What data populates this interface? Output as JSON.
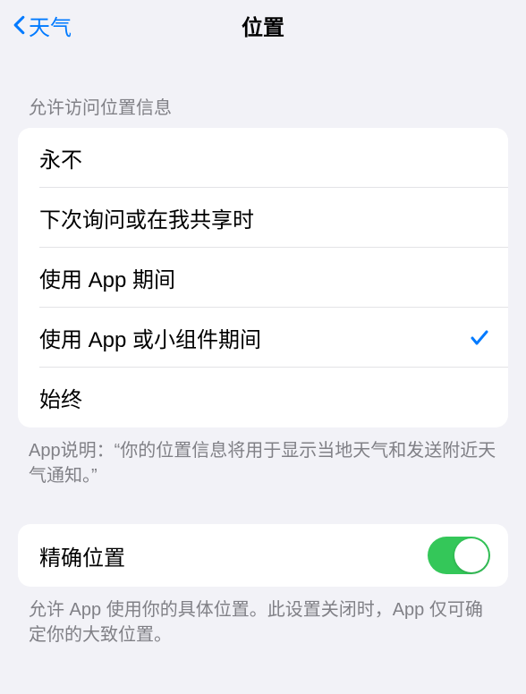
{
  "navbar": {
    "back_label": "天气",
    "title": "位置"
  },
  "section1": {
    "header": "允许访问位置信息",
    "options": [
      {
        "label": "永不",
        "selected": false
      },
      {
        "label": "下次询问或在我共享时",
        "selected": false
      },
      {
        "label": "使用 App 期间",
        "selected": false
      },
      {
        "label": "使用 App 或小组件期间",
        "selected": true
      },
      {
        "label": "始终",
        "selected": false
      }
    ],
    "footer": "App说明：“你的位置信息将用于显示当地天气和发送附近天气通知。”"
  },
  "section2": {
    "precise_label": "精确位置",
    "precise_enabled": true,
    "footer": "允许 App 使用你的具体位置。此设置关闭时，App 仅可确定你的大致位置。"
  }
}
